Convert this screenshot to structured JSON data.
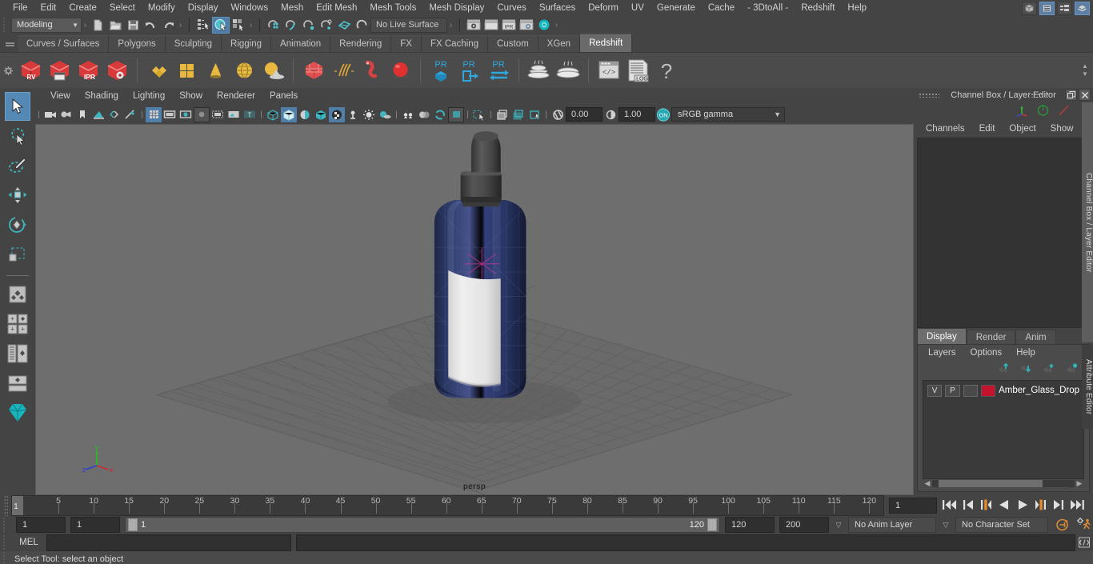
{
  "menubar": {
    "items": [
      "File",
      "Edit",
      "Create",
      "Select",
      "Modify",
      "Display",
      "Windows",
      "Mesh",
      "Edit Mesh",
      "Mesh Tools",
      "Mesh Display",
      "Curves",
      "Surfaces",
      "Deform",
      "UV",
      "Generate",
      "Cache",
      "- 3DtoAll -",
      "Redshift",
      "Help"
    ],
    "window_icons": [
      "cube-icon",
      "outliner-icon",
      "list-icon",
      "layers-icon"
    ]
  },
  "statusline": {
    "mode": "Modeling",
    "mode_caret": "▼",
    "live_surface": "No Live Surface",
    "icons": [
      "new-scene-icon",
      "open-scene-icon",
      "save-scene-icon",
      "undo-icon",
      "redo-icon",
      "select-hierarchy-icon",
      "select-object-icon",
      "select-component-icon",
      "snap-grid-icon",
      "snap-curve-icon",
      "snap-point-icon",
      "snap-projected-icon",
      "snap-view-plane-icon",
      "make-live-icon",
      "render-view-icon",
      "render-icon",
      "ipr-render-icon",
      "render-settings-icon",
      "hypershade-icon"
    ]
  },
  "shelf": {
    "tabs": [
      "Curves / Surfaces",
      "Polygons",
      "Sculpting",
      "Rigging",
      "Animation",
      "Rendering",
      "FX",
      "FX Caching",
      "Custom",
      "XGen",
      "Redshift"
    ],
    "active_tab": "Redshift",
    "buttons": [
      "redshift-rv-icon",
      "redshift-sequence-icon",
      "redshift-ipr-icon",
      "redshift-settings-icon",
      "rs-material-icon",
      "rs-texture-icon",
      "rs-light-dome-icon",
      "rs-sphere-light-icon",
      "rs-sky-icon",
      "rs-proxy-icon",
      "rs-hair-icon",
      "rs-volume-icon",
      "rs-sphere-icon",
      "pr-cube-icon",
      "pr-export-icon",
      "pr-transfer-icon",
      "rs-bake-icon",
      "rs-bake2-icon",
      "rs-script-icon",
      "rs-log-icon",
      "rs-help-icon"
    ],
    "labels": {
      "rv": "RV",
      "ipr": "IPR",
      "pr": "PR",
      "log": ".LOG",
      "help": "?"
    }
  },
  "toolbox": {
    "tools": [
      "select-tool",
      "lasso-select-tool",
      "paint-select-tool",
      "move-tool",
      "rotate-tool",
      "scale-tool",
      "last-tool",
      "quick-layout-single",
      "quick-layout-four",
      "quick-layout-outliner-persp",
      "quick-layout-hypershade",
      "quick-layout-persp-graph",
      "maya-logo-icon"
    ],
    "active": "select-tool"
  },
  "viewport": {
    "menus": [
      "View",
      "Shading",
      "Lighting",
      "Show",
      "Renderer",
      "Panels"
    ],
    "toolbar_icons": [
      "camera-icon",
      "camera-attributes-icon",
      "bookmark-icon",
      "image-plane-icon",
      "two-sided-lighting-icon",
      "shadows-icon",
      "grid-toggle-icon",
      "film-gate-icon",
      "resolution-gate-icon",
      "gate-mask-icon",
      "film-origin-icon",
      "safe-action-icon",
      "title-safe-icon",
      "wireframe-icon",
      "smooth-shade-icon",
      "shaded-wire-icon",
      "hardware-texture-icon",
      "xray-icon",
      "xray-joints-icon",
      "lighting-icon",
      "shadow-pass-icon",
      "screen-space-ao-icon",
      "motion-blur-icon",
      "multisample-icon",
      "depth-of-field-icon",
      "isolate-select-icon",
      "snapshot-icon",
      "grab-icon",
      "exposure-icon"
    ],
    "exposure": "0.00",
    "gamma": "1.00",
    "color_toggle": "ON",
    "color_space": "sRGB gamma",
    "color_caret": "▼",
    "camera_label": "persp",
    "axis_labels": {
      "x": "x",
      "y": "y",
      "z": "z"
    },
    "scene": {
      "object": "Amber Glass Dropper Bottle",
      "bottle_glass_color": "#2c3a6e",
      "label_color": "#e8e8e8",
      "dropper_cap_color": "#4a4a4a",
      "background_color": "#6e6e6e"
    }
  },
  "rightpanel": {
    "title": "Channel Box / Layer Editor",
    "win_buttons": [
      "undock-icon",
      "close-icon"
    ],
    "top_icons": [
      "move-axis-icon",
      "rotate-ring-icon",
      "scale-line-icon"
    ],
    "channelbox_menus": [
      "Channels",
      "Edit",
      "Object",
      "Show"
    ],
    "layer_tabs": [
      "Display",
      "Render",
      "Anim"
    ],
    "layer_tab_active": "Display",
    "layer_menus": [
      "Layers",
      "Options",
      "Help"
    ],
    "layer_buttons": [
      "move-layer-up-icon",
      "move-layer-down-icon",
      "new-layer-icon",
      "new-layer-from-selected-icon"
    ],
    "layers": [
      {
        "visibility": "V",
        "playback": "P",
        "shading": "",
        "color": "#c4122f",
        "name": "Amber_Glass_Dropper_"
      }
    ],
    "vertical_tabs": [
      "Channel Box / Layer Editor",
      "Attribute Editor"
    ]
  },
  "timeline": {
    "ticks": [
      5,
      10,
      15,
      20,
      25,
      30,
      35,
      40,
      45,
      50,
      55,
      60,
      65,
      70,
      75,
      80,
      85,
      90,
      95,
      100,
      105,
      110,
      115,
      120
    ],
    "current_frame_marker": "1",
    "current_frame_field": "1",
    "playback_buttons": [
      "go-to-start-icon",
      "step-back-keyframe-icon",
      "step-back-frame-icon",
      "play-backwards-icon",
      "play-forwards-icon",
      "step-forward-frame-icon",
      "step-forward-keyframe-icon",
      "go-to-end-icon"
    ]
  },
  "rangeslider": {
    "anim_start": "1",
    "range_start": "1",
    "bar_start_label": "1",
    "bar_end_label": "120",
    "range_end": "120",
    "anim_end": "200",
    "anim_layer": "No Anim Layer",
    "character_set": "No Character Set",
    "caret": "▽",
    "right_icons": [
      "auto-key-icon",
      "animation-preferences-icon"
    ]
  },
  "commandline": {
    "language_label": "MEL",
    "input_value": "",
    "script-editor-icon": "script-editor-icon"
  },
  "helpline": {
    "text": "Select Tool: select an object"
  }
}
